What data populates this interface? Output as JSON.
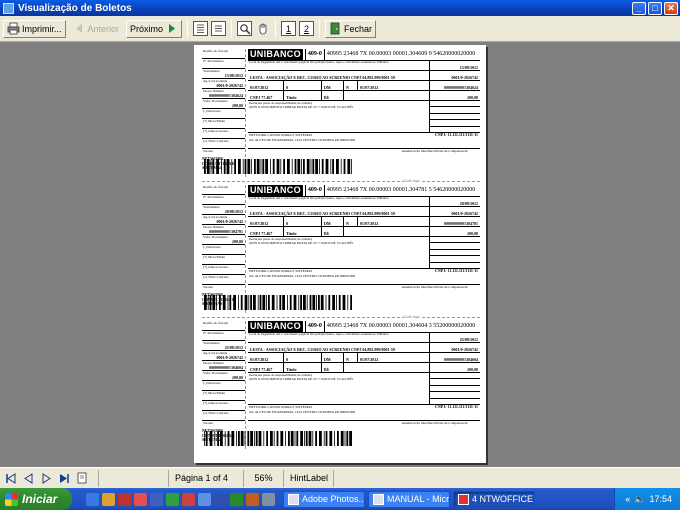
{
  "window": {
    "title": "Visualização de Boletos",
    "min": "_",
    "max": "□",
    "close": "✕"
  },
  "toolbar": {
    "print_label": "Imprimir...",
    "prev_label": "Anterior",
    "next_label": "Próximo",
    "page1": "1",
    "page2": "2",
    "close_label": "Fechar"
  },
  "boletos": [
    {
      "bank": "UNIBANCO",
      "bank_code": "409-0",
      "line": "40995 23468 7X 00.00003 00001.304609 9 54620000020000",
      "cut_label": "Corte Aqui",
      "recibo": {
        "title": "Recibo do Sacado",
        "doc_label": "Nº Documento",
        "due_label": "Vencimento",
        "due": "15/08/2012",
        "agency_label": "Ag./Cód.Cedente",
        "agency": "0001/0-2026742",
        "nosso_label": "Nosso Número",
        "nosso": "00000000001304624",
        "value_label": "Valor Documento",
        "value": "200,00",
        "desc_label": "(-) Desconto",
        "mora_label": "(+) Mora/Multa",
        "outros_label": "(+) Outros Acrésc.",
        "cobrado_label": "(=) Valor Cobrado",
        "sacado_label": "Sacado",
        "sacado": "NETWORK CONSULTORIA E SISTEMAS"
      },
      "local_label": "Local do Pagamento",
      "local": "Até o vencimento pagável em qualquer banco. Após o vencimento somente no Unibanco",
      "venc": "15/08/2012",
      "cedente": "LESTA - ASSOCIAÇÃO E REC. CURSO AO SCREENIO CNPJ 04.892.999/0001-59",
      "agcod": "0001/0-2026742",
      "data_doc": "01/07/2012",
      "num_doc": "0",
      "especie": "DM",
      "aceite": "N",
      "data_proc": "01/07/2012",
      "nosso": "00000000001304624",
      "carteira": "Título",
      "moeda": "R$",
      "valor": "200,00",
      "uso_banco": "CNPJ 77.467",
      "instr_label": "Instruções (texto de responsabilidade do cedente)",
      "instr": "APÓS O VENCIMENTO COBRAR MULTA DE 2% + JUROS DE 1% AO MÊS",
      "sacado": "NETWORK CONSULTORIA E SISTEMAS",
      "sacado_addr": "AV. ALVES DE FIGUEIREDO, 1234 CENTRO CURITIBA PR 80000-000",
      "cnpj": "CNPJ: 11.111.111/1111-11",
      "auth": "Autenticação Mecânica/Ficha de Compensação"
    },
    {
      "bank": "UNIBANCO",
      "bank_code": "409-0",
      "line": "40995 23468 7X 00.00003 00001.304781 5 54620000020000",
      "cut_label": "Corte Aqui",
      "recibo": {
        "title": "Recibo do Sacado",
        "doc_label": "Nº Documento",
        "due_label": "Vencimento",
        "due": "20/08/2012",
        "agency_label": "Ag./Cód.Cedente",
        "agency": "0001/0-2026742",
        "nosso_label": "Nosso Número",
        "nosso": "00000000001304781",
        "value_label": "Valor Documento",
        "value": "200,00",
        "desc_label": "(-) Desconto",
        "mora_label": "(+) Mora/Multa",
        "outros_label": "(+) Outros Acrésc.",
        "cobrado_label": "(=) Valor Cobrado",
        "sacado_label": "Sacado",
        "sacado": "NETWORK CONSULTORIA E SISTEMAS"
      },
      "local_label": "Local do Pagamento",
      "local": "Até o vencimento pagável em qualquer banco. Após o vencimento somente no Unibanco",
      "venc": "20/08/2012",
      "cedente": "LESTA - ASSOCIAÇÃO E REC. CURSO AO SCREENIO CNPJ 04.892.999/0001-59",
      "agcod": "0001/0-2026742",
      "data_doc": "01/07/2012",
      "num_doc": "0",
      "especie": "DM",
      "aceite": "N",
      "data_proc": "01/07/2012",
      "nosso": "00000000001304781",
      "carteira": "Título",
      "moeda": "R$",
      "valor": "200,00",
      "uso_banco": "CNPJ 77.467",
      "instr_label": "Instruções (texto de responsabilidade do cedente)",
      "instr": "APÓS O VENCIMENTO COBRAR MULTA DE 2% + JUROS DE 1% AO MÊS",
      "sacado": "NETWORK CONSULTORIA E SISTEMAS",
      "sacado_addr": "AV. ALVES DE FIGUEIREDO, 1234 CENTRO CURITIBA PR 80000-000",
      "cnpj": "CNPJ: 11.111.111/1111-11",
      "auth": "Autenticação Mecânica/Ficha de Compensação"
    },
    {
      "bank": "UNIBANCO",
      "bank_code": "409-0",
      "line": "40995 23468 7X 00.00003 00001.304604 3 55200000020000",
      "cut_label": "Corte Aqui",
      "recibo": {
        "title": "Recibo do Sacado",
        "doc_label": "Nº Documento",
        "due_label": "Vencimento",
        "due": "25/08/2012",
        "agency_label": "Ag./Cód.Cedente",
        "agency": "0001/0-2026742",
        "nosso_label": "Nosso Número",
        "nosso": "00000000001304604",
        "value_label": "Valor Documento",
        "value": "200,00",
        "desc_label": "(-) Desconto",
        "mora_label": "(+) Mora/Multa",
        "outros_label": "(+) Outros Acrésc.",
        "cobrado_label": "(=) Valor Cobrado",
        "sacado_label": "Sacado",
        "sacado": "NETWORK CONSULTORIA E SISTEMAS"
      },
      "local_label": "Local do Pagamento",
      "local": "Até o vencimento pagável em qualquer banco. Após o vencimento somente no Unibanco",
      "venc": "25/08/2012",
      "cedente": "LESTA - ASSOCIAÇÃO E REC. CURSO AO SCREENIO CNPJ 04.892.999/0001-59",
      "agcod": "0001/0-2026742",
      "data_doc": "01/07/2012",
      "num_doc": "0",
      "especie": "DM",
      "aceite": "N",
      "data_proc": "01/07/2012",
      "nosso": "00000000001304604",
      "carteira": "Título",
      "moeda": "R$",
      "valor": "200,00",
      "uso_banco": "CNPJ 77.467",
      "instr_label": "Instruções (texto de responsabilidade do cedente)",
      "instr": "APÓS O VENCIMENTO COBRAR MULTA DE 2% + JUROS DE 1% AO MÊS",
      "sacado": "NETWORK CONSULTORIA E SISTEMAS",
      "sacado_addr": "AV. ALVES DE FIGUEIREDO, 1234 CENTRO CURITIBA PR 80000-000",
      "cnpj": "CNPJ: 11.111.111/1111-11",
      "auth": "Autenticação Mecânica/Ficha de Compensação"
    }
  ],
  "status": {
    "page": "Página 1 of 4",
    "zoom": "56%",
    "hint": "HintLabel"
  },
  "taskbar": {
    "start_label": "Iniciar",
    "tasks": [
      {
        "label": "Adobe Photos..."
      },
      {
        "label": "MANUAL - Micr..."
      },
      {
        "label": "4 NTWOFFICE"
      }
    ],
    "clock": "17:54"
  },
  "colors": {
    "titlebar": "#0a5ce6",
    "taskbar": "#2459c9",
    "start": "#2e8b2e",
    "toolbar": "#ece9d8",
    "preview_bg": "#808080"
  }
}
